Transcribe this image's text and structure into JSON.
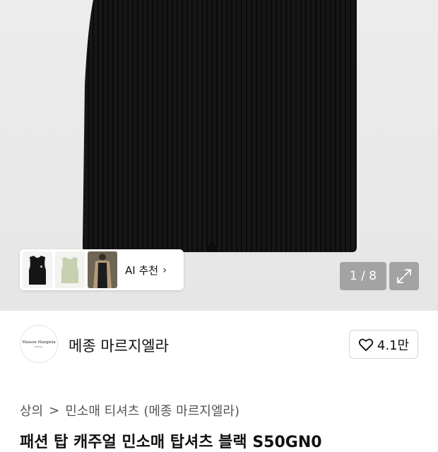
{
  "recommendation": {
    "label": "AI 추천",
    "chevron": "›"
  },
  "gallery": {
    "counter": "1 / 8"
  },
  "brand": {
    "name": "메종 마르지엘라",
    "logo_line1": "Maison Margiela",
    "logo_line2": "PARIS"
  },
  "like": {
    "count": "4.1만"
  },
  "breadcrumb": {
    "items": [
      "상의",
      "민소매 티셔츠",
      "(메종 마르지엘라)"
    ],
    "sep": ">"
  },
  "product": {
    "title_partial": "패션 탑 캐주얼 민소매 탑셔츠 블랙 S50GN0"
  },
  "colors": {
    "garment": "#141414",
    "hero_bg": "#e8e8e8",
    "overlay": "#8c8c8c"
  }
}
